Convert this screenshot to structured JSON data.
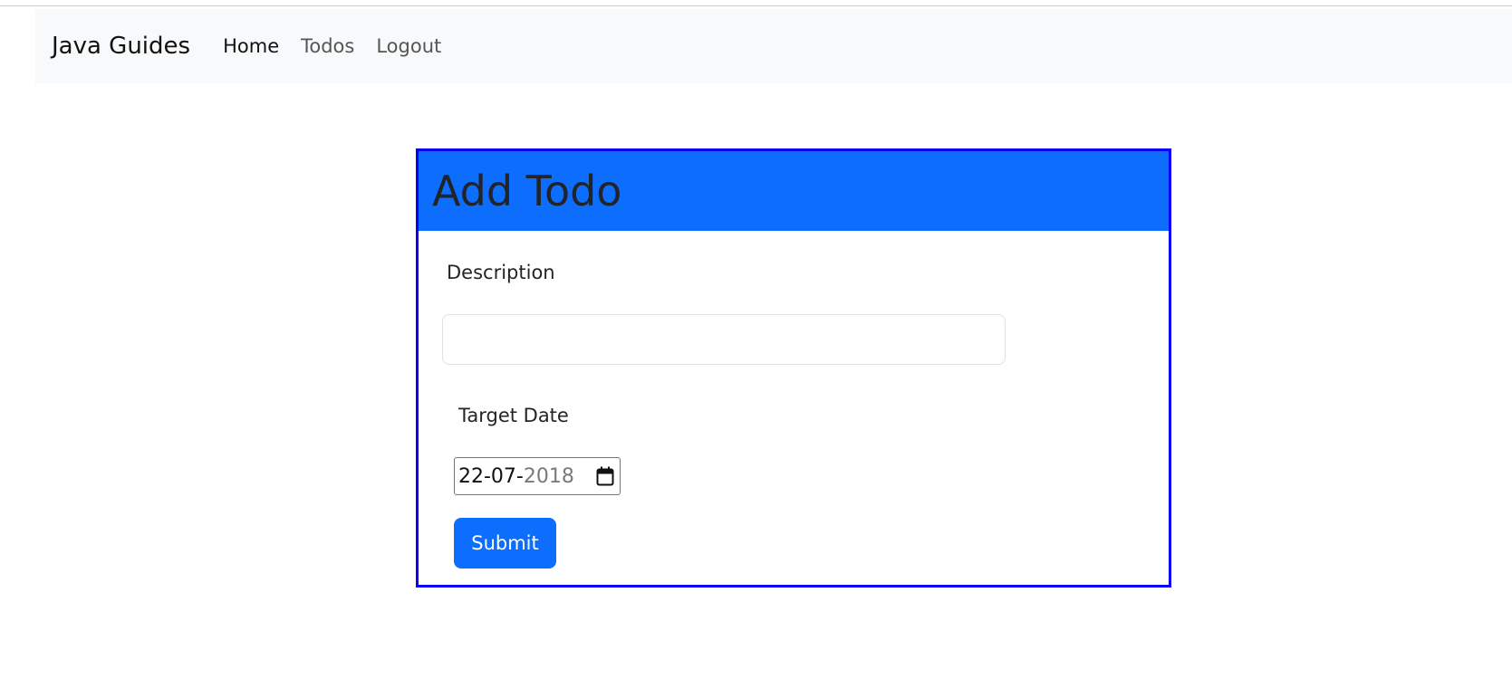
{
  "navbar": {
    "brand": "Java Guides",
    "links": [
      {
        "label": "Home",
        "active": true
      },
      {
        "label": "Todos",
        "active": false
      },
      {
        "label": "Logout",
        "active": false
      }
    ]
  },
  "form": {
    "title": "Add Todo",
    "description_label": "Description",
    "description_value": "",
    "target_date_label": "Target Date",
    "target_date_value_day_month": "22-07-",
    "target_date_value_year": "2018",
    "submit_label": "Submit"
  },
  "colors": {
    "header_bg": "#0d6efd",
    "card_border": "#0a00f5",
    "button_bg": "#0d6efd",
    "navbar_bg": "#f8f9fa"
  },
  "icons": {
    "date_picker": "calendar-icon"
  }
}
